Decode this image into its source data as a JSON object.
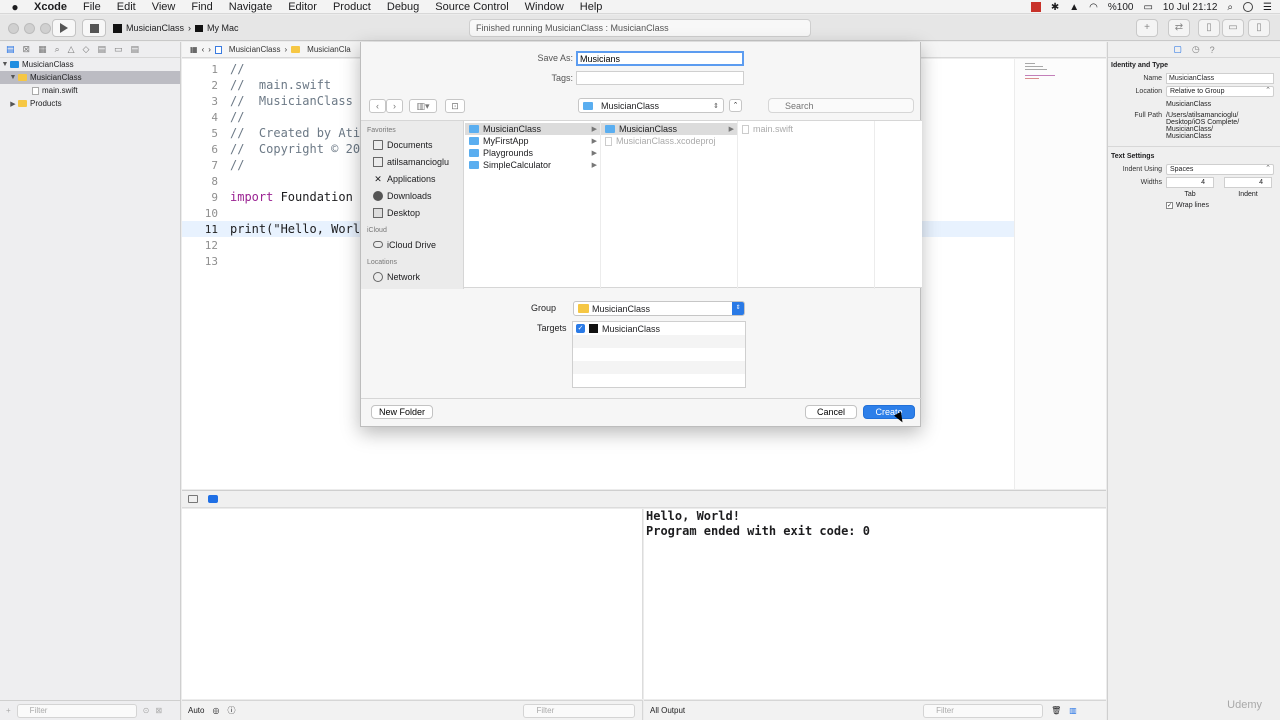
{
  "menubar": {
    "app": "Xcode",
    "menus": [
      "File",
      "Edit",
      "View",
      "Find",
      "Navigate",
      "Editor",
      "Product",
      "Debug",
      "Source Control",
      "Window",
      "Help"
    ],
    "battery": "%100",
    "clock": "10 Jul  21:12"
  },
  "toolbar": {
    "scheme": "MusicianClass",
    "destination": "My Mac",
    "status": "Finished running MusicianClass : MusicianClass"
  },
  "navigator": {
    "items": [
      {
        "label": "MusicianClass",
        "kind": "project"
      },
      {
        "label": "MusicianClass",
        "kind": "folder"
      },
      {
        "label": "main.swift",
        "kind": "file"
      },
      {
        "label": "Products",
        "kind": "folder"
      }
    ],
    "filter_placeholder": "Filter"
  },
  "jumpbar": {
    "crumbs": [
      "MusicianClass",
      "MusicianCla"
    ]
  },
  "editor": {
    "lines": [
      {
        "n": "1",
        "text": "//"
      },
      {
        "n": "2",
        "text": "//  main.swift"
      },
      {
        "n": "3",
        "text": "//  MusicianClass"
      },
      {
        "n": "4",
        "text": "//"
      },
      {
        "n": "5",
        "text": "//  Created by Ati"
      },
      {
        "n": "6",
        "text": "//  Copyright © 20"
      },
      {
        "n": "7",
        "text": "//"
      },
      {
        "n": "8",
        "text": ""
      },
      {
        "n": "9",
        "kw": "import",
        "text": " Foundation"
      },
      {
        "n": "10",
        "text": ""
      },
      {
        "n": "11",
        "text": "print(\"Hello, Worl"
      },
      {
        "n": "12",
        "text": ""
      },
      {
        "n": "13",
        "text": ""
      }
    ]
  },
  "console": {
    "lines": [
      "Hello, World!",
      "Program ended with exit code: 0"
    ],
    "output_select": "All Output",
    "auto_select": "Auto",
    "filter_placeholder": "Filter"
  },
  "inspector": {
    "section1": "Identity and Type",
    "name_label": "Name",
    "name_value": "MusicianClass",
    "location_label": "Location",
    "location_value": "Relative to Group",
    "location_path": "MusicianClass",
    "fullpath_label": "Full Path",
    "fullpath_lines": [
      "/Users/atilsamancioglu/",
      "Desktop/iOS Complete/",
      "MusicianClass/",
      "MusicianClass"
    ],
    "section2": "Text Settings",
    "indent_label": "Indent Using",
    "indent_value": "Spaces",
    "widths_label": "Widths",
    "tab_value": "4",
    "indent_num": "4",
    "tab_caption": "Tab",
    "indent_caption": "Indent",
    "wrap_label": "Wrap lines"
  },
  "sheet": {
    "saveas_label": "Save As:",
    "saveas_value": "Musicians",
    "tags_label": "Tags:",
    "location": "MusicianClass",
    "search_placeholder": "Search",
    "favorites_label": "Favorites",
    "favorites": [
      "Documents",
      "atilsamancioglu",
      "Applications",
      "Downloads",
      "Desktop"
    ],
    "icloud_label": "iCloud",
    "icloud": [
      "iCloud Drive"
    ],
    "locations_label": "Locations",
    "locations": [
      "Network"
    ],
    "col1": [
      "MusicianClass",
      "MyFirstApp",
      "Playgrounds",
      "SimpleCalculator"
    ],
    "col2": [
      "MusicianClass",
      "MusicianClass.xcodeproj"
    ],
    "col3": [
      "main.swift"
    ],
    "group_label": "Group",
    "group_value": "MusicianClass",
    "targets_label": "Targets",
    "target": "MusicianClass",
    "new_folder": "New Folder",
    "cancel": "Cancel",
    "create": "Create"
  },
  "watermark": "Udemy",
  "colors": {
    "accent": "#2d7fe9",
    "keyword": "#9b2393",
    "comment": "#6c7986",
    "folder": "#f6c744"
  }
}
